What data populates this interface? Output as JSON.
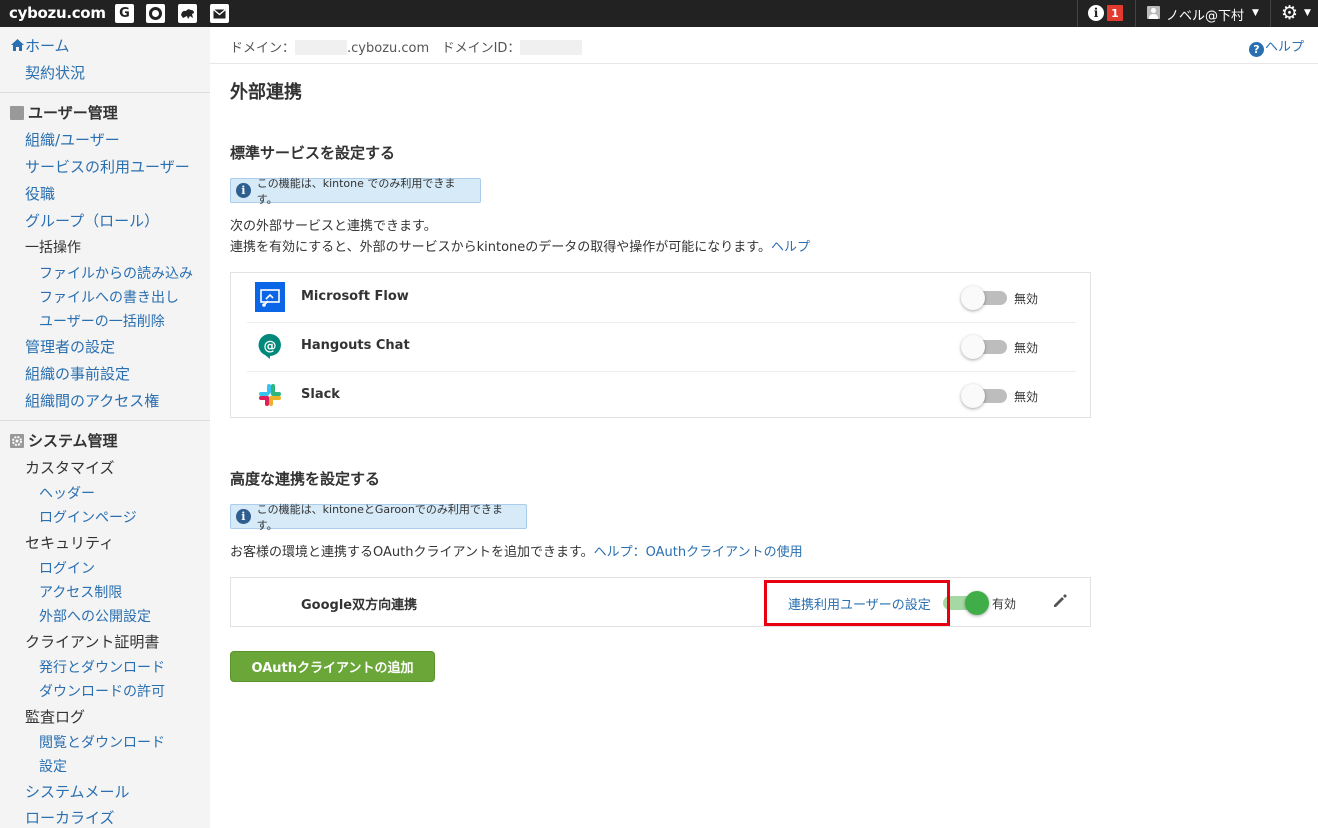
{
  "topbar": {
    "logo": "cybozu.com",
    "app_icons": [
      "G",
      "O",
      "kintone",
      "mail"
    ],
    "notification_count": "1",
    "user_name": "ノベル@下村"
  },
  "sidebar": {
    "home": "ホーム",
    "contract": "契約状況",
    "user_mgmt": {
      "title": "ユーザー管理",
      "items": [
        "組織/ユーザー",
        "サービスの利用ユーザー",
        "役職",
        "グループ（ロール）",
        "一括操作"
      ],
      "bulk_sub": [
        "ファイルからの読み込み",
        "ファイルへの書き出し",
        "ユーザーの一括削除"
      ],
      "items2": [
        "管理者の設定",
        "組織の事前設定",
        "組織間のアクセス権"
      ]
    },
    "sys_mgmt": {
      "title": "システム管理",
      "customize": "カスタマイズ",
      "customize_sub": [
        "ヘッダー",
        "ログインページ"
      ],
      "security": "セキュリティ",
      "security_sub": [
        "ログイン",
        "アクセス制限",
        "外部への公開設定"
      ],
      "cert": "クライアント証明書",
      "cert_sub": [
        "発行とダウンロード",
        "ダウンロードの許可"
      ],
      "audit": "監査ログ",
      "audit_sub": [
        "閲覧とダウンロード",
        "設定"
      ],
      "system_mail": "システムメール",
      "localize": "ローカライズ"
    }
  },
  "domain_bar": {
    "domain_label": "ドメイン：",
    "domain_suffix": ".cybozu.com",
    "domain_id_label": "ドメインID：",
    "help": "ヘルプ"
  },
  "main": {
    "page_title": "外部連携",
    "standard": {
      "title": "標準サービスを設定する",
      "note": "この機能は、kintone でのみ利用できます。",
      "desc1": "次の外部サービスと連携できます。",
      "desc2": "連携を有効にすると、外部のサービスからkintoneのデータの取得や操作が可能になります。",
      "desc2_link": "ヘルプ",
      "services": [
        {
          "name": "Microsoft Flow",
          "status": "無効",
          "icon": "microsoft-flow-icon"
        },
        {
          "name": "Hangouts Chat",
          "status": "無効",
          "icon": "hangouts-chat-icon"
        },
        {
          "name": "Slack",
          "status": "無効",
          "icon": "slack-icon"
        }
      ]
    },
    "advanced": {
      "title": "高度な連携を設定する",
      "note": "この機能は、kintoneとGaroonでのみ利用できます。",
      "desc": "お客様の環境と連携するOAuthクライアントを追加できます。",
      "desc_link": "ヘルプ：OAuthクライアントの使用",
      "client": {
        "name": "Google双方向連携",
        "user_setting_link": "連携利用ユーザーの設定",
        "status": "有効"
      },
      "add_button": "OAuthクライアントの追加"
    }
  },
  "colors": {
    "topbar": "#222222",
    "link": "#2a6fb0",
    "toggle_on": "#3fae49",
    "add_button": "#6aa638",
    "highlight": "#e60012"
  }
}
